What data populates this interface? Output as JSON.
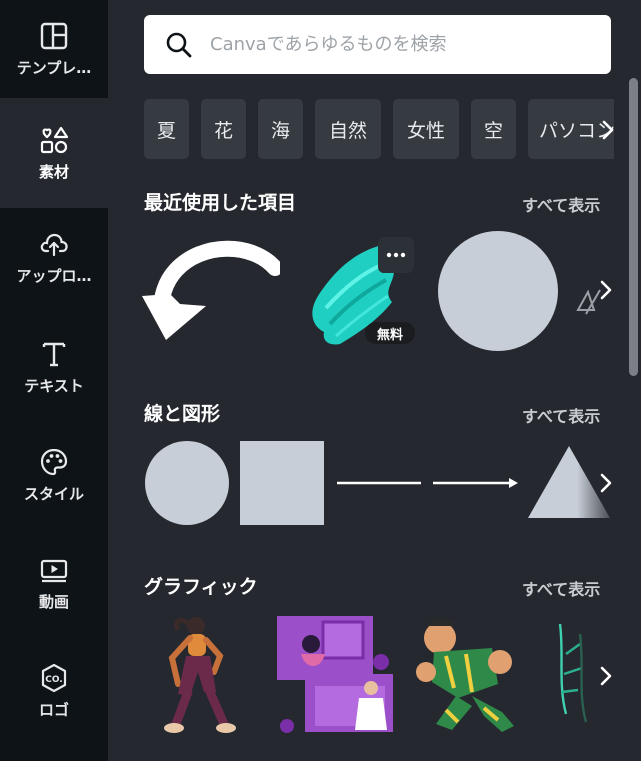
{
  "sidebar": {
    "items": [
      {
        "label": "テンプレ…",
        "icon": "template-icon"
      },
      {
        "label": "素材",
        "icon": "elements-icon"
      },
      {
        "label": "アップロ…",
        "icon": "upload-cloud-icon"
      },
      {
        "label": "テキスト",
        "icon": "text-icon"
      },
      {
        "label": "スタイル",
        "icon": "palette-icon"
      },
      {
        "label": "動画",
        "icon": "video-icon"
      },
      {
        "label": "ロゴ",
        "icon": "logo-co-icon"
      }
    ],
    "active_label": "素材"
  },
  "search": {
    "placeholder": "Canvaであらゆるものを検索"
  },
  "chips": [
    "夏",
    "花",
    "海",
    "自然",
    "女性",
    "空",
    "パソコン"
  ],
  "sections": {
    "recent": {
      "title": "最近使用した項目",
      "see_all": "すべて表示",
      "badge": "無料"
    },
    "shapes": {
      "title": "線と図形",
      "see_all": "すべて表示"
    },
    "graphics": {
      "title": "グラフィック",
      "see_all": "すべて表示"
    }
  },
  "colors": {
    "sidebar_bg": "#0e1318",
    "panel_bg": "#25282e",
    "chip_bg": "#363a41",
    "shape_fill": "#c8ced7",
    "accent_teal": "#20d4c4"
  }
}
